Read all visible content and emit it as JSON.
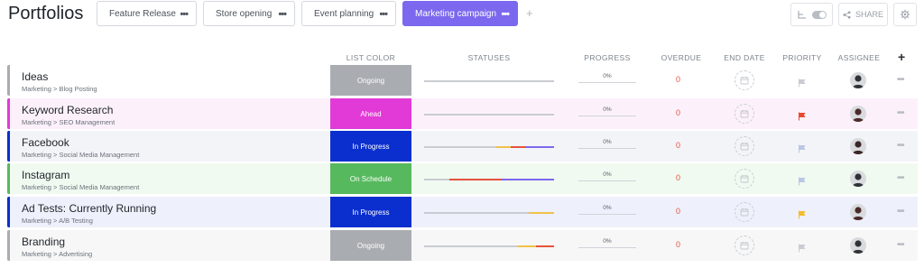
{
  "page": {
    "title": "Portfolios"
  },
  "tabs": [
    {
      "label": "Feature Release",
      "active": false
    },
    {
      "label": "Store opening",
      "active": false
    },
    {
      "label": "Event planning",
      "active": false
    },
    {
      "label": "Marketing campaign",
      "active": true
    }
  ],
  "tab_more": "•••",
  "add_tab": "+",
  "toolbar": {
    "share_label": "SHARE"
  },
  "columns": {
    "list_color": "LIST COLOR",
    "statuses": "STATUSES",
    "progress": "PROGRESS",
    "overdue": "OVERDUE",
    "end_date": "END DATE",
    "priority": "PRIORITY",
    "assignee": "ASSIGNEE",
    "add": "+"
  },
  "rows": [
    {
      "name": "Ideas",
      "crumb": "Marketing > Blog Posting",
      "status": "Ongoing",
      "progress": "0%",
      "overdue": "0",
      "color": "#a9acb1",
      "bg": "#ffffff",
      "flag_color": "#c9ccd1"
    },
    {
      "name": "Keyword Research",
      "crumb": "Marketing > SEO Management",
      "status": "Ahead",
      "progress": "0%",
      "overdue": "0",
      "color": "#e23ad6",
      "bg": "#fcf1fb",
      "flag_color": "#e8492f"
    },
    {
      "name": "Facebook",
      "crumb": "Marketing > Social Media Management",
      "status": "In Progress",
      "progress": "0%",
      "overdue": "0",
      "color": "#0b2fcf",
      "bg": "#f3f4f8",
      "flag_color": "#b9c6e4"
    },
    {
      "name": "Instagram",
      "crumb": "Marketing > Social Media Management",
      "status": "On Schedule",
      "progress": "0%",
      "overdue": "0",
      "color": "#57b95e",
      "bg": "#f1faf1",
      "flag_color": "#b9c6e4"
    },
    {
      "name": "Ad Tests: Currently Running",
      "crumb": "Marketing > A/B Testing",
      "status": "In Progress",
      "progress": "0%",
      "overdue": "0",
      "color": "#0b2fcf",
      "bg": "#eef0fb",
      "flag_color": "#f3bd2c"
    },
    {
      "name": "Branding",
      "crumb": "Marketing > Advertising",
      "status": "Ongoing",
      "progress": "0%",
      "overdue": "0",
      "color": "#a9acb1",
      "bg": "#f7f7f7",
      "flag_color": "#c9ccd1"
    }
  ],
  "row_more": "•••"
}
